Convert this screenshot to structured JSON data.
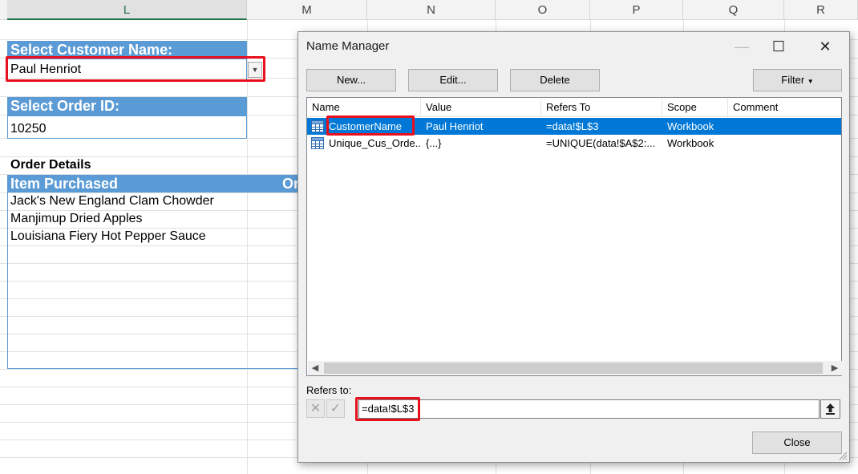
{
  "sheet": {
    "columns": [
      "L",
      "M",
      "N",
      "O",
      "P",
      "Q",
      "R"
    ],
    "select_customer_label": "Select Customer Name:",
    "customer_value": "Paul Henriot",
    "select_order_label": "Select Order ID:",
    "order_value": "10250",
    "order_details_label": "Order Details",
    "item_purchased_header": "Item Purchased",
    "truncated_header": "Or",
    "items": [
      "Jack's New England Clam Chowder",
      "Manjimup Dried Apples",
      "Louisiana Fiery Hot Pepper Sauce"
    ]
  },
  "dialog": {
    "title": "Name Manager",
    "minimize_icon": "—",
    "maximize_icon": "☐",
    "close_icon": "✕",
    "buttons": {
      "new_label": "New...",
      "edit_label": "Edit...",
      "delete_label": "Delete",
      "filter_label": "Filter",
      "close_label": "Close"
    },
    "columns": [
      "Name",
      "Value",
      "Refers To",
      "Scope",
      "Comment"
    ],
    "rows": [
      {
        "name": "CustomerName",
        "value": "Paul Henriot",
        "refers_to": "=data!$L$3",
        "scope": "Workbook",
        "comment": "",
        "selected": true
      },
      {
        "name": "Unique_Cus_Orde...",
        "value": "{...}",
        "refers_to": "=UNIQUE(data!$A$2:...",
        "scope": "Workbook",
        "comment": "",
        "selected": false
      }
    ],
    "refers_to_label": "Refers to:",
    "refers_to_value": "=data!$L$3"
  },
  "colors": {
    "header_blue": "#5b9bd5",
    "selection_blue": "#0078d7",
    "highlight_red": "#e8101e",
    "excel_green": "#217346"
  }
}
